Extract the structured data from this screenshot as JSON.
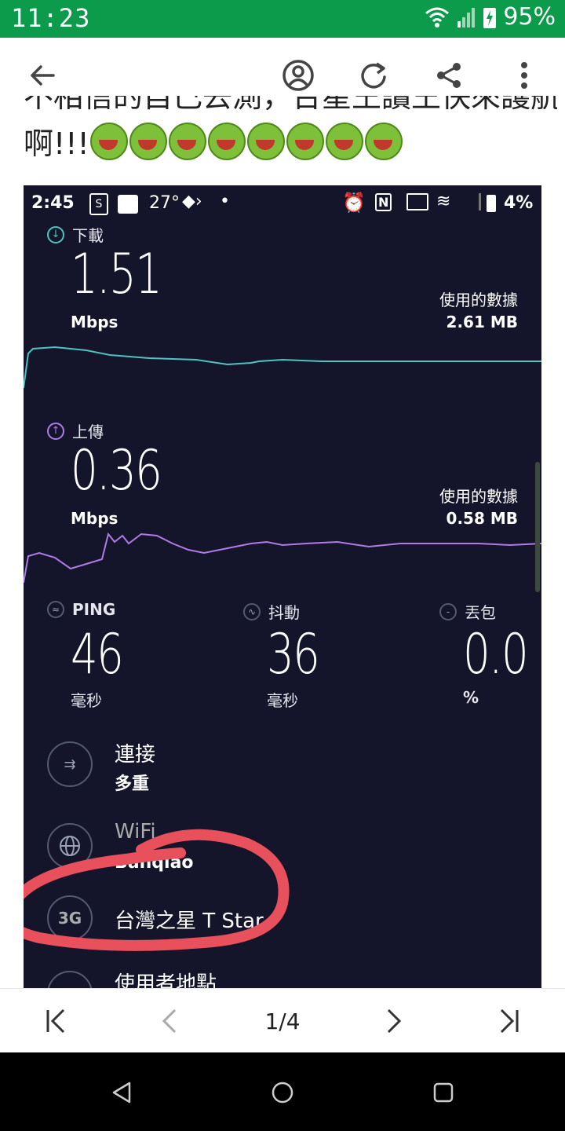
{
  "status_bar": {
    "time": "11:23",
    "battery": "95%"
  },
  "toolbar": {
    "icons": [
      "back-arrow-icon",
      "account-icon",
      "refresh-icon",
      "share-icon",
      "more-icon"
    ]
  },
  "post": {
    "line1": "不相信的自己去測，台星王讀王快來護航",
    "line2": "啊!!!",
    "emoji_count": 8
  },
  "embedded": {
    "status": {
      "time": "2:45",
      "temp": "27°",
      "battery": "4%"
    },
    "download": {
      "label": "下載",
      "value": "1.51",
      "unit": "Mbps",
      "used_label": "使用的數據",
      "used_value": "2.61 MB"
    },
    "upload": {
      "label": "上傳",
      "value": "0.36",
      "unit": "Mbps",
      "used_label": "使用的數據",
      "used_value": "0.58 MB"
    },
    "ping": {
      "label": "PING",
      "value": "46",
      "unit": "毫秒"
    },
    "jitter": {
      "label": "抖動",
      "value": "36",
      "unit": "毫秒"
    },
    "loss": {
      "label": "丟包",
      "value": "0.0",
      "unit": "%"
    },
    "connection": {
      "title": "連接",
      "value": "多重"
    },
    "wifi": {
      "title": "WiFi",
      "value": "Banqiao"
    },
    "carrier": {
      "badge": "3G",
      "title": "台灣之星 T Star"
    },
    "location": {
      "title": "使用者地點"
    },
    "colors": {
      "download_line": "#4fc3c0",
      "upload_line": "#b07be6",
      "annotation": "#e8505b"
    }
  },
  "pager": {
    "label": "1/4"
  }
}
